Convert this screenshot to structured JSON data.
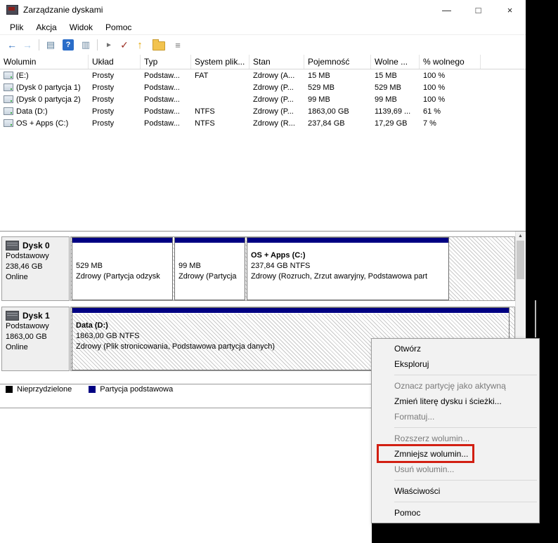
{
  "window": {
    "title": "Zarządzanie dyskami",
    "controls": {
      "minimize": "—",
      "maximize": "□",
      "close": "×"
    }
  },
  "menu_bar": {
    "items": [
      "Plik",
      "Akcja",
      "Widok",
      "Pomoc"
    ]
  },
  "toolbar": {
    "icons": [
      {
        "name": "back-icon",
        "glyph": "←"
      },
      {
        "name": "forward-icon",
        "glyph": "→"
      },
      {
        "name": "show-console-tree-icon",
        "glyph": "▤"
      },
      {
        "name": "help-icon",
        "glyph": "?"
      },
      {
        "name": "show-action-pane-icon",
        "glyph": "▥"
      },
      {
        "name": "pointer-icon",
        "glyph": "►"
      },
      {
        "name": "check-disk-icon",
        "glyph": "✓"
      },
      {
        "name": "up-arrow-icon",
        "glyph": "↑"
      },
      {
        "name": "open-folder-icon",
        "glyph": ""
      },
      {
        "name": "export-list-icon",
        "glyph": "≡"
      }
    ]
  },
  "volume_table": {
    "columns": [
      "Wolumin",
      "Układ",
      "Typ",
      "System plik...",
      "Stan",
      "Pojemność",
      "Wolne ...",
      "% wolnego"
    ],
    "rows": [
      {
        "volume": "(E:)",
        "layout": "Prosty",
        "type": "Podstaw...",
        "filesystem": "FAT",
        "status": "Zdrowy (A...",
        "capacity": "15 MB",
        "free": "15 MB",
        "percent_free": "100 %"
      },
      {
        "volume": "(Dysk 0 partycja 1)",
        "layout": "Prosty",
        "type": "Podstaw...",
        "filesystem": "",
        "status": "Zdrowy (P...",
        "capacity": "529 MB",
        "free": "529 MB",
        "percent_free": "100 %"
      },
      {
        "volume": "(Dysk 0 partycja 2)",
        "layout": "Prosty",
        "type": "Podstaw...",
        "filesystem": "",
        "status": "Zdrowy (P...",
        "capacity": "99 MB",
        "free": "99 MB",
        "percent_free": "100 %"
      },
      {
        "volume": "Data (D:)",
        "layout": "Prosty",
        "type": "Podstaw...",
        "filesystem": "NTFS",
        "status": "Zdrowy (P...",
        "capacity": "1863,00 GB",
        "free": "1139,69 ...",
        "percent_free": "61 %"
      },
      {
        "volume": "OS + Apps (C:)",
        "layout": "Prosty",
        "type": "Podstaw...",
        "filesystem": "NTFS",
        "status": "Zdrowy (R...",
        "capacity": "237,84 GB",
        "free": "17,29 GB",
        "percent_free": "7 %"
      }
    ]
  },
  "disks": [
    {
      "label": "Dysk 0",
      "kind": "Podstawowy",
      "size": "238,46 GB",
      "status": "Online",
      "partitions": [
        {
          "title": "",
          "size": "529 MB",
          "status": "Zdrowy (Partycja odzysk",
          "selected": false
        },
        {
          "title": "",
          "size": "99 MB",
          "status": "Zdrowy (Partycja",
          "selected": false
        },
        {
          "title": "OS + Apps  (C:)",
          "size": "237,84 GB NTFS",
          "status": "Zdrowy (Rozruch, Zrzut awaryjny, Podstawowa part",
          "selected": false
        }
      ]
    },
    {
      "label": "Dysk 1",
      "kind": "Podstawowy",
      "size": "1863,00 GB",
      "status": "Online",
      "partitions": [
        {
          "title": "Data  (D:)",
          "size": "1863,00 GB NTFS",
          "status": "Zdrowy (Plik stronicowania, Podstawowa partycja danych)",
          "selected": true
        }
      ]
    }
  ],
  "legend": {
    "items": [
      {
        "label": "Nieprzydzielone",
        "color": "#000000"
      },
      {
        "label": "Partycja podstawowa",
        "color": "#000082"
      }
    ]
  },
  "scrollbar": {
    "up": "▲",
    "down": "▼"
  },
  "context_menu": {
    "items": [
      {
        "label": "Otwórz",
        "enabled": true
      },
      {
        "label": "Eksploruj",
        "enabled": true
      },
      {
        "label": "Oznacz partycję jako aktywną",
        "enabled": false
      },
      {
        "label": "Zmień literę dysku i ścieżki...",
        "enabled": true
      },
      {
        "label": "Formatuj...",
        "enabled": false
      },
      {
        "label": "Rozszerz wolumin...",
        "enabled": false
      },
      {
        "label": "Zmniejsz wolumin...",
        "enabled": true,
        "annotated": true
      },
      {
        "label": "Usuń wolumin...",
        "enabled": false
      },
      {
        "label": "Właściwości",
        "enabled": true
      },
      {
        "label": "Pomoc",
        "enabled": true
      }
    ]
  },
  "colors": {
    "partition_stripe": "#000082",
    "annotation": "#d21f12"
  }
}
